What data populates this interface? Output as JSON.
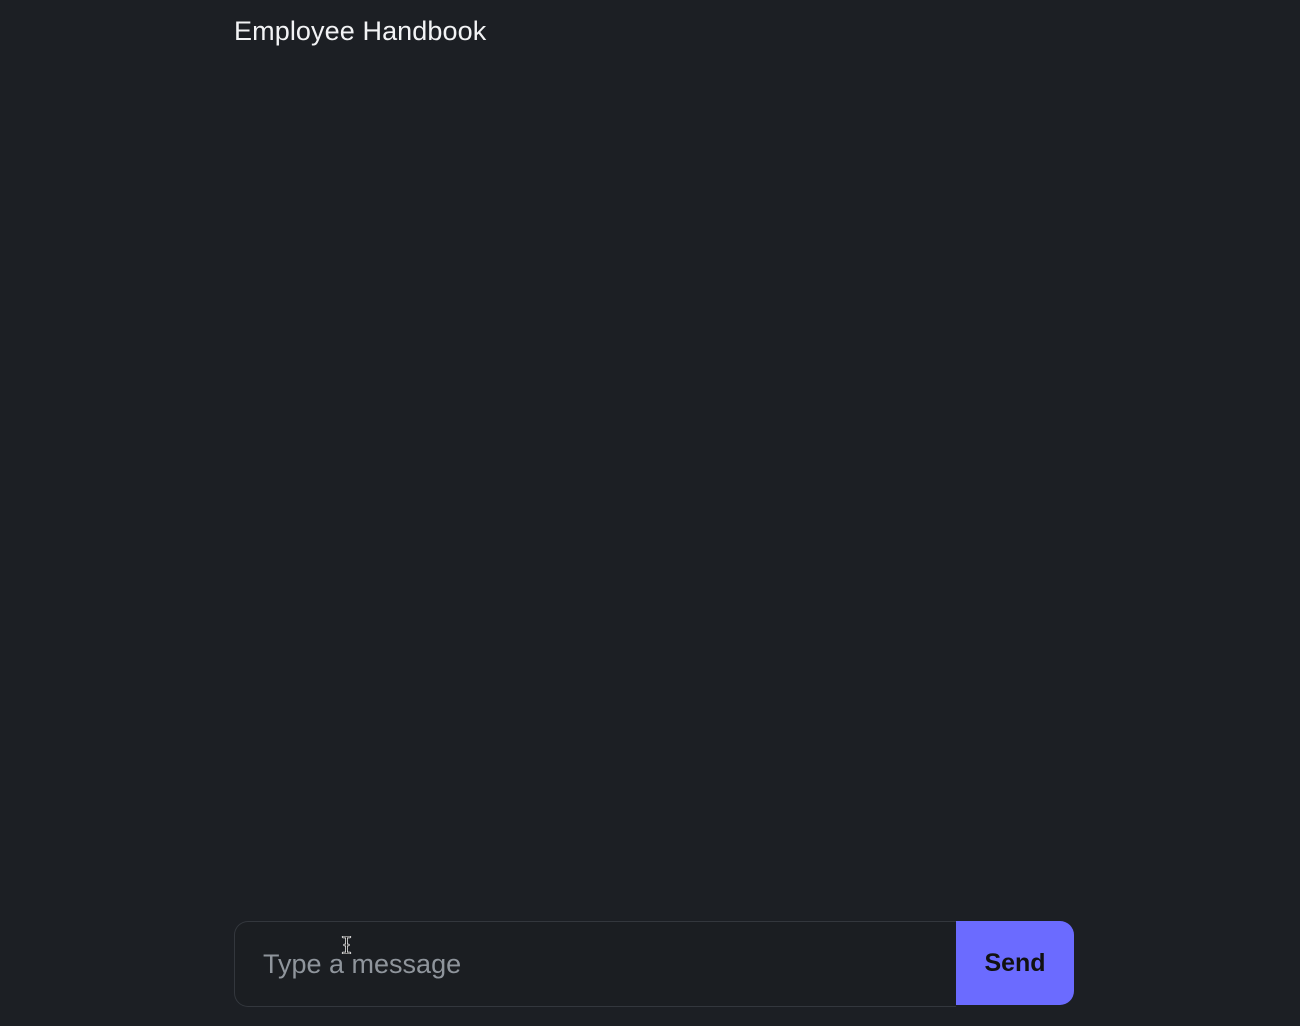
{
  "header": {
    "title": "Employee Handbook"
  },
  "composer": {
    "input_value": "",
    "input_placeholder": "Type a message",
    "send_label": "Send"
  },
  "colors": {
    "background": "#1c1f24",
    "accent": "#6b6bff",
    "title_text": "#f2f3f5",
    "placeholder_text": "#8f959c"
  },
  "icons": {
    "pointer": "text-cursor-icon"
  }
}
